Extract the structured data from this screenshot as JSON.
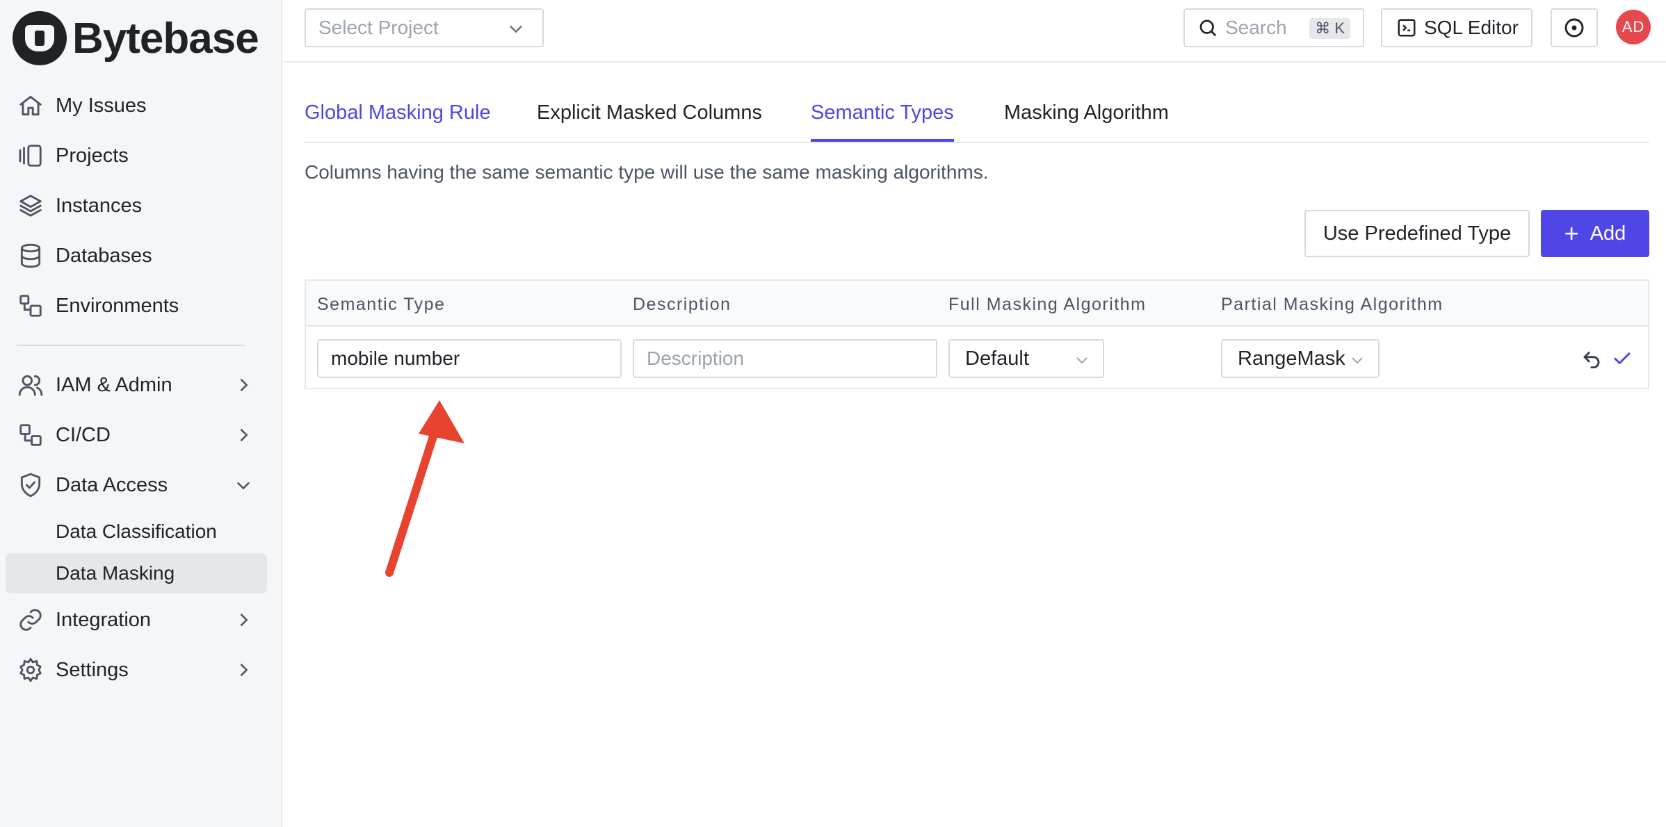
{
  "brand": {
    "name": "Bytebase"
  },
  "sidebar": {
    "items": [
      {
        "label": "My Issues",
        "icon": "home-icon"
      },
      {
        "label": "Projects",
        "icon": "projects-icon"
      },
      {
        "label": "Instances",
        "icon": "layers-icon"
      },
      {
        "label": "Databases",
        "icon": "database-icon"
      },
      {
        "label": "Environments",
        "icon": "environments-icon"
      }
    ],
    "groups": [
      {
        "label": "IAM & Admin",
        "icon": "users-icon"
      },
      {
        "label": "CI/CD",
        "icon": "cicd-icon"
      },
      {
        "label": "Data Access",
        "icon": "shield-icon",
        "expanded": true,
        "children": [
          {
            "label": "Data Classification"
          },
          {
            "label": "Data Masking",
            "active": true
          }
        ]
      },
      {
        "label": "Integration",
        "icon": "link-icon"
      },
      {
        "label": "Settings",
        "icon": "gear-icon"
      }
    ]
  },
  "topbar": {
    "select_project_placeholder": "Select Project",
    "search_placeholder": "Search",
    "search_shortcut": "⌘ K",
    "sql_editor_label": "SQL Editor",
    "avatar_initials": "AD"
  },
  "tabs": [
    {
      "label": "Global Masking Rule",
      "state": "link"
    },
    {
      "label": "Explicit Masked Columns",
      "state": "normal"
    },
    {
      "label": "Semantic Types",
      "state": "active"
    },
    {
      "label": "Masking Algorithm",
      "state": "normal"
    }
  ],
  "description": "Columns having the same semantic type will use the same masking algorithms.",
  "actions": {
    "use_predefined_label": "Use Predefined Type",
    "add_label": "Add"
  },
  "table": {
    "columns": [
      "Semantic Type",
      "Description",
      "Full Masking Algorithm",
      "Partial Masking Algorithm"
    ],
    "rows": [
      {
        "semantic_type_value": "mobile number",
        "description_value": "",
        "description_placeholder": "Description",
        "full_masking": "Default",
        "partial_masking": "RangeMask"
      }
    ]
  },
  "colors": {
    "accent": "#4f46e5",
    "annotation_arrow": "#e8432e",
    "avatar": "#e5484d"
  }
}
